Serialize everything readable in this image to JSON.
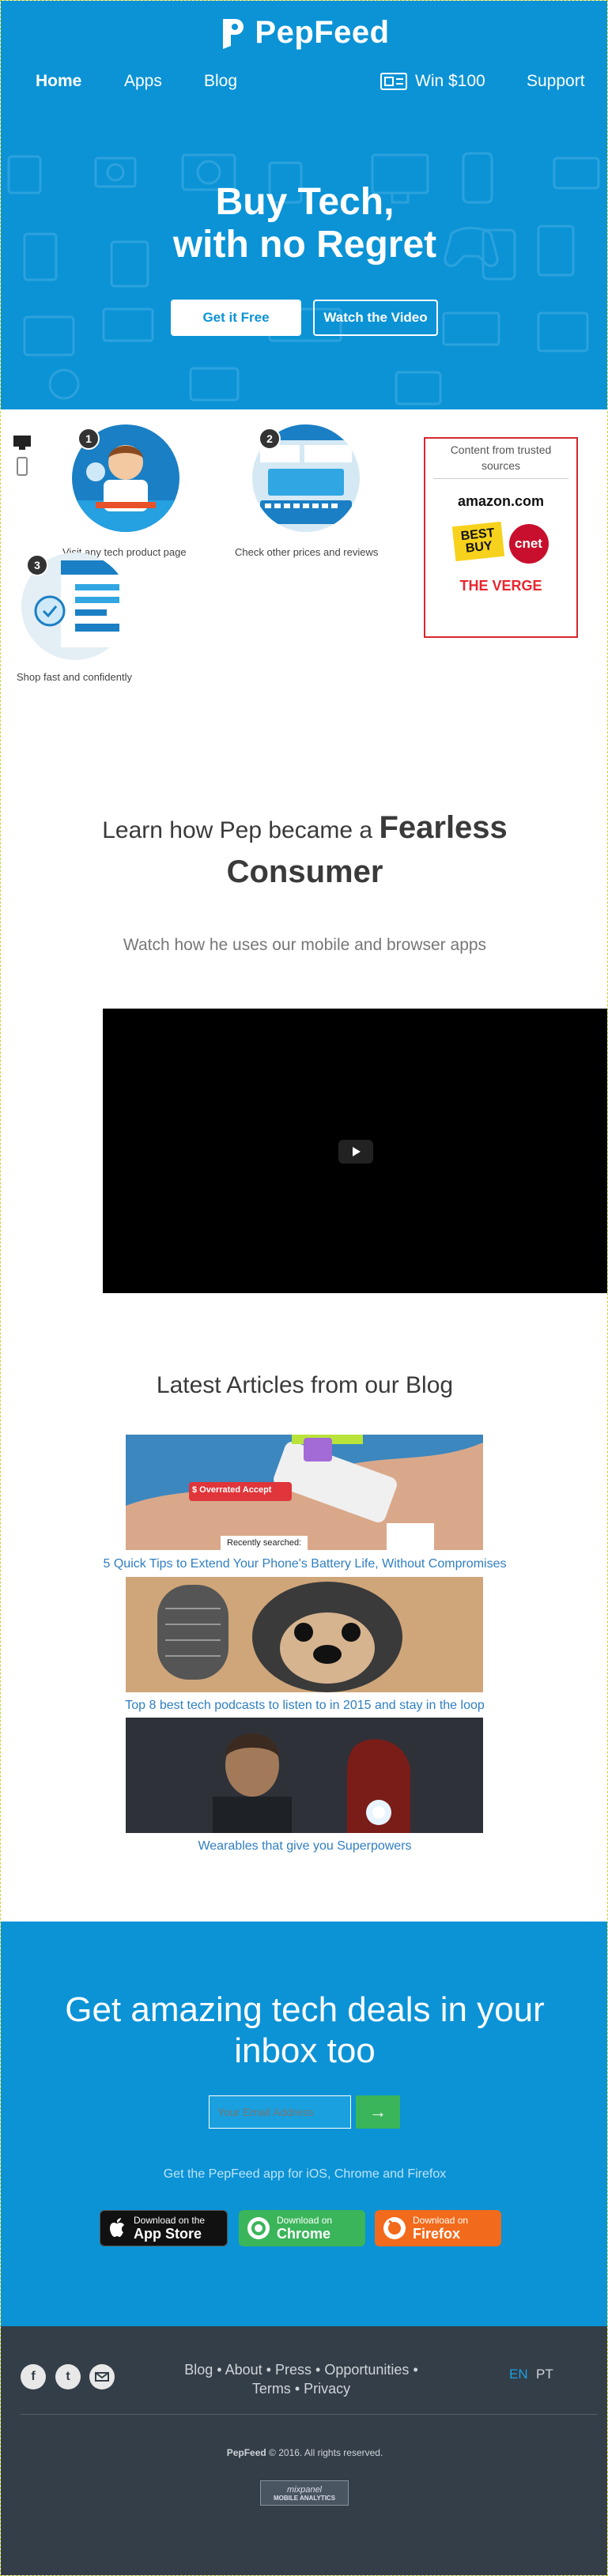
{
  "header": {
    "brand": "PepFeed",
    "nav": {
      "home": "Home",
      "apps": "Apps",
      "blog": "Blog",
      "win": "Win $100",
      "support": "Support"
    }
  },
  "hero": {
    "title_line1": "Buy Tech,",
    "title_line2": "with no Regret",
    "get_free": "Get it Free",
    "watch_video": "Watch the Video"
  },
  "steps": [
    {
      "number": "1",
      "caption": "Visit any tech product page"
    },
    {
      "number": "2",
      "caption": "Check other prices and reviews"
    },
    {
      "number": "3",
      "caption": "Shop fast and confidently"
    }
  ],
  "sources": {
    "title": "Content from trusted sources",
    "logos": [
      "amazon.com",
      "BEST BUY",
      "cnet",
      "THE VERGE"
    ]
  },
  "learn": {
    "prefix": "Learn how Pep became a",
    "bold1": "Fearless",
    "bold2": "Consumer",
    "subtitle": "Watch how he uses our mobile and browser apps"
  },
  "blog": {
    "title": "Latest Articles from our Blog",
    "articles": [
      {
        "title": "5 Quick Tips to Extend Your Phone's Battery Life, Without Compromises",
        "image_labels": [
          "$ Overrated Accept",
          "Recently searched:"
        ]
      },
      {
        "title": "Top 8 best tech podcasts to listen to in 2015 and stay in the loop"
      },
      {
        "title": "Wearables that give you Superpowers"
      }
    ]
  },
  "cta": {
    "title_line1": "Get amazing tech deals in your",
    "title_line2": "inbox too",
    "email_placeholder": "Your Email Address",
    "submit": "→",
    "apps_text": "Get the PepFeed app for iOS, Chrome and Firefox",
    "stores": [
      {
        "line1": "Download on the",
        "line2": "App Store",
        "color": "#111111"
      },
      {
        "line1": "Download on",
        "line2": "Chrome",
        "color": "#3bb55a"
      },
      {
        "line1": "Download on",
        "line2": "Firefox",
        "color": "#f26a1b"
      }
    ]
  },
  "footer": {
    "social": [
      "facebook-icon",
      "twitter-icon",
      "email-icon"
    ],
    "links_row1": [
      "Blog",
      "About",
      "Press",
      "Opportunities"
    ],
    "links_row2": [
      "Terms",
      "Privacy"
    ],
    "sep": "•",
    "lang_en": "EN",
    "lang_pt": "PT",
    "copyright_brand": "PepFeed",
    "copyright_text": "© 2016. All rights reserved.",
    "badge_line1": "mixpanel",
    "badge_line2": "MOBILE ANALYTICS"
  },
  "colors": {
    "brand_blue": "#0b93d6",
    "cta_green": "#3bb55a",
    "footer": "#343e48",
    "link_blue": "#2f7fc1"
  }
}
